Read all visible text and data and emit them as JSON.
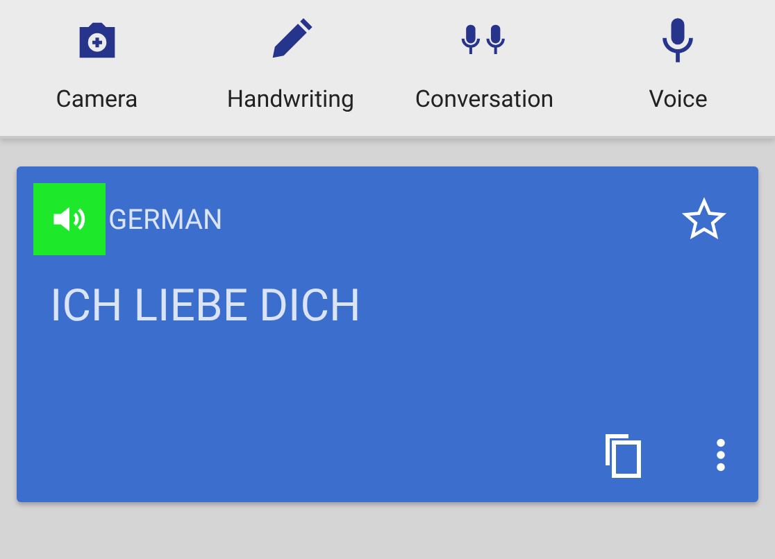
{
  "input_modes": [
    {
      "label": "Camera",
      "kind": "camera"
    },
    {
      "label": "Handwriting",
      "kind": "pen"
    },
    {
      "label": "Conversation",
      "kind": "mics"
    },
    {
      "label": "Voice",
      "kind": "mic"
    }
  ],
  "translation_card": {
    "speaker_highlighted": true,
    "language": "GERMAN",
    "text": "ICH LIEBE DICH",
    "starred": false
  }
}
